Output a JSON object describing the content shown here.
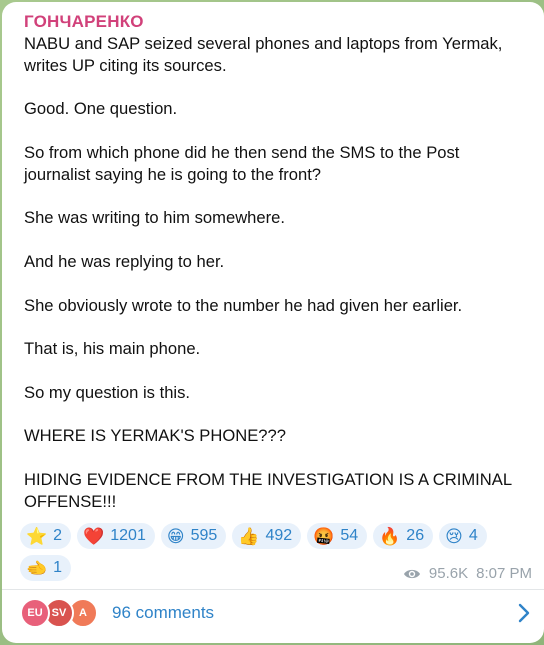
{
  "message": {
    "sender": "ГОНЧАРЕНКО",
    "paragraphs": [
      "NABU and SAP seized several phones and laptops from Yermak, writes UP citing its sources.",
      "Good. One question.",
      "So from which phone did he then send the SMS to the Post journalist saying he is going to the front?",
      "She was writing to him somewhere.",
      "And he was replying to her.",
      "She obviously wrote to the number he had given her earlier.",
      "That is, his main phone.",
      "So my question is this.",
      "WHERE IS YERMAK'S PHONE???",
      "HIDING EVIDENCE FROM THE INVESTIGATION IS A CRIMINAL OFFENSE!!!"
    ]
  },
  "reactions": [
    {
      "emoji": "⭐",
      "icon": "star-icon",
      "count": "2"
    },
    {
      "emoji": "❤️",
      "icon": "heart-icon",
      "count": "1201"
    },
    {
      "emoji": "😁",
      "icon": "grin-icon",
      "count": "595"
    },
    {
      "emoji": "👍",
      "icon": "thumbs-up-icon",
      "count": "492"
    },
    {
      "emoji": "🤬",
      "icon": "angry-icon",
      "count": "54"
    },
    {
      "emoji": "🔥",
      "icon": "fire-icon",
      "count": "26"
    },
    {
      "emoji": "😢",
      "icon": "crying-icon",
      "count": "4"
    },
    {
      "emoji": "🫲",
      "icon": "pointing-hand-icon",
      "count": "1"
    }
  ],
  "meta": {
    "views": "95.6K",
    "time": "8:07 PM"
  },
  "comments": {
    "label": "96 comments",
    "avatars": [
      {
        "initials": "EU",
        "color": "#e8607a"
      },
      {
        "initials": "SV",
        "color": "#d9534f"
      },
      {
        "initials": "A",
        "color": "#f07a58"
      }
    ]
  },
  "colors": {
    "sender": "#d1417a",
    "accent": "#2f83c8",
    "reaction_bg": "#e8f1fb",
    "meta": "#99a3ab"
  }
}
